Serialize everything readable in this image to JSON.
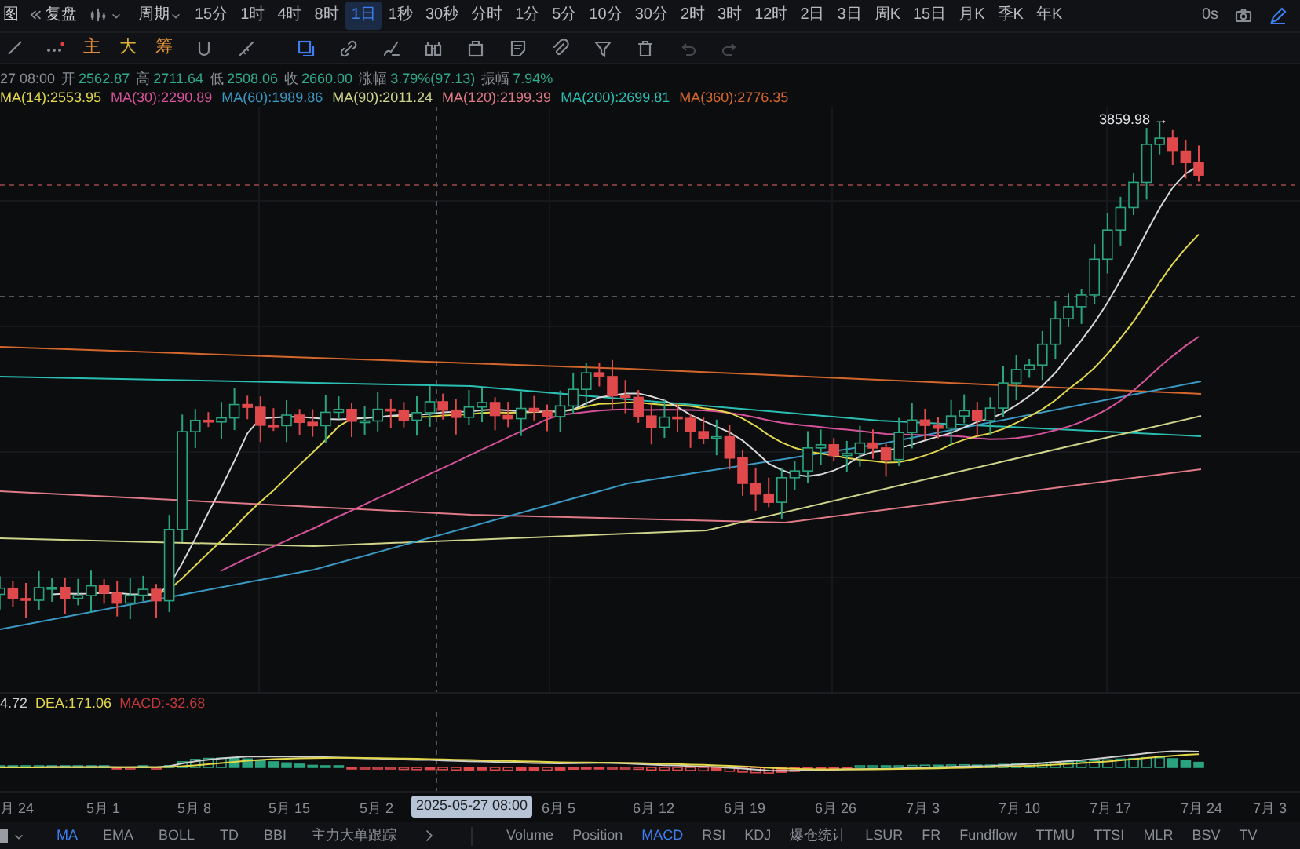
{
  "toolbar": {
    "layout_label": "图",
    "replay_label": "复盘",
    "period_label": "周期",
    "periods": [
      {
        "label": "15分",
        "selected": false
      },
      {
        "label": "1时",
        "selected": false
      },
      {
        "label": "4时",
        "selected": false
      },
      {
        "label": "8时",
        "selected": false
      },
      {
        "label": "1日",
        "selected": true
      },
      {
        "label": "1秒",
        "selected": false
      },
      {
        "label": "30秒",
        "selected": false
      },
      {
        "label": "分时",
        "selected": false
      },
      {
        "label": "1分",
        "selected": false
      },
      {
        "label": "5分",
        "selected": false
      },
      {
        "label": "10分",
        "selected": false
      },
      {
        "label": "30分",
        "selected": false
      },
      {
        "label": "2时",
        "selected": false
      },
      {
        "label": "3时",
        "selected": false
      },
      {
        "label": "12时",
        "selected": false
      },
      {
        "label": "2日",
        "selected": false
      },
      {
        "label": "3日",
        "selected": false
      },
      {
        "label": "周K",
        "selected": false
      },
      {
        "label": "15日",
        "selected": false
      },
      {
        "label": "月K",
        "selected": false
      },
      {
        "label": "季K",
        "selected": false
      },
      {
        "label": "年K",
        "selected": false
      }
    ],
    "refresh_label": "0s"
  },
  "drawing_tools": {
    "text_buttons": [
      {
        "label": "主",
        "color": "#e08a3c"
      },
      {
        "label": "大",
        "color": "#d9b23a"
      },
      {
        "label": "筹",
        "color": "#e0913c"
      }
    ]
  },
  "ohlc": {
    "time": "27 08:00",
    "fields": [
      {
        "label": "开",
        "value": "2562.87"
      },
      {
        "label": "高",
        "value": "2711.64"
      },
      {
        "label": "低",
        "value": "2508.06"
      },
      {
        "label": "收",
        "value": "2660.00"
      },
      {
        "label": "涨幅",
        "value": "3.79%(97.13)"
      },
      {
        "label": "振幅",
        "value": "7.94%"
      }
    ]
  },
  "ma_legend": [
    {
      "text": "MA(14):2553.95",
      "color": "#e3d74a"
    },
    {
      "text": "MA(30):2290.89",
      "color": "#d6539b"
    },
    {
      "text": "MA(60):1989.86",
      "color": "#3b9ac4"
    },
    {
      "text": "MA(90):2011.24",
      "color": "#cfd48a"
    },
    {
      "text": "MA(120):2199.39",
      "color": "#e07a88"
    },
    {
      "text": "MA(200):2699.81",
      "color": "#2bbfb3"
    },
    {
      "text": "MA(360):2776.35",
      "color": "#d5672c"
    }
  ],
  "price_label": "3859.98 →",
  "macd_legend": [
    {
      "text": "4.72",
      "color": "#cfcfcf"
    },
    {
      "text": "DEA:171.06",
      "color": "#e3d74a"
    },
    {
      "text": "MACD:-32.68",
      "color": "#c0393b"
    }
  ],
  "date_axis": {
    "labels": [
      "月 24",
      "5月 1",
      "5月 8",
      "5月 15",
      "5月 2",
      "6月 5",
      "6月 12",
      "6月 19",
      "6月 26",
      "7月 3",
      "7月 10",
      "7月 17",
      "7月 24",
      "7月 3"
    ],
    "crosshair_label": "2025-05-27 08:00"
  },
  "indicators": {
    "main": [
      {
        "label": "MA",
        "selected": true
      },
      {
        "label": "EMA",
        "selected": false
      },
      {
        "label": "BOLL",
        "selected": false
      },
      {
        "label": "TD",
        "selected": false
      },
      {
        "label": "BBI",
        "selected": false
      },
      {
        "label": "主力大单跟踪",
        "selected": false
      }
    ],
    "sub": [
      {
        "label": "Volume",
        "selected": false
      },
      {
        "label": "Position",
        "selected": false
      },
      {
        "label": "MACD",
        "selected": true
      },
      {
        "label": "RSI",
        "selected": false
      },
      {
        "label": "KDJ",
        "selected": false
      },
      {
        "label": "爆仓统计",
        "selected": false
      },
      {
        "label": "LSUR",
        "selected": false
      },
      {
        "label": "FR",
        "selected": false
      },
      {
        "label": "Fundflow",
        "selected": false
      },
      {
        "label": "TTMU",
        "selected": false
      },
      {
        "label": "TTSI",
        "selected": false
      },
      {
        "label": "MLR",
        "selected": false
      },
      {
        "label": "BSV",
        "selected": false
      },
      {
        "label": "TV",
        "selected": false
      }
    ]
  }
}
